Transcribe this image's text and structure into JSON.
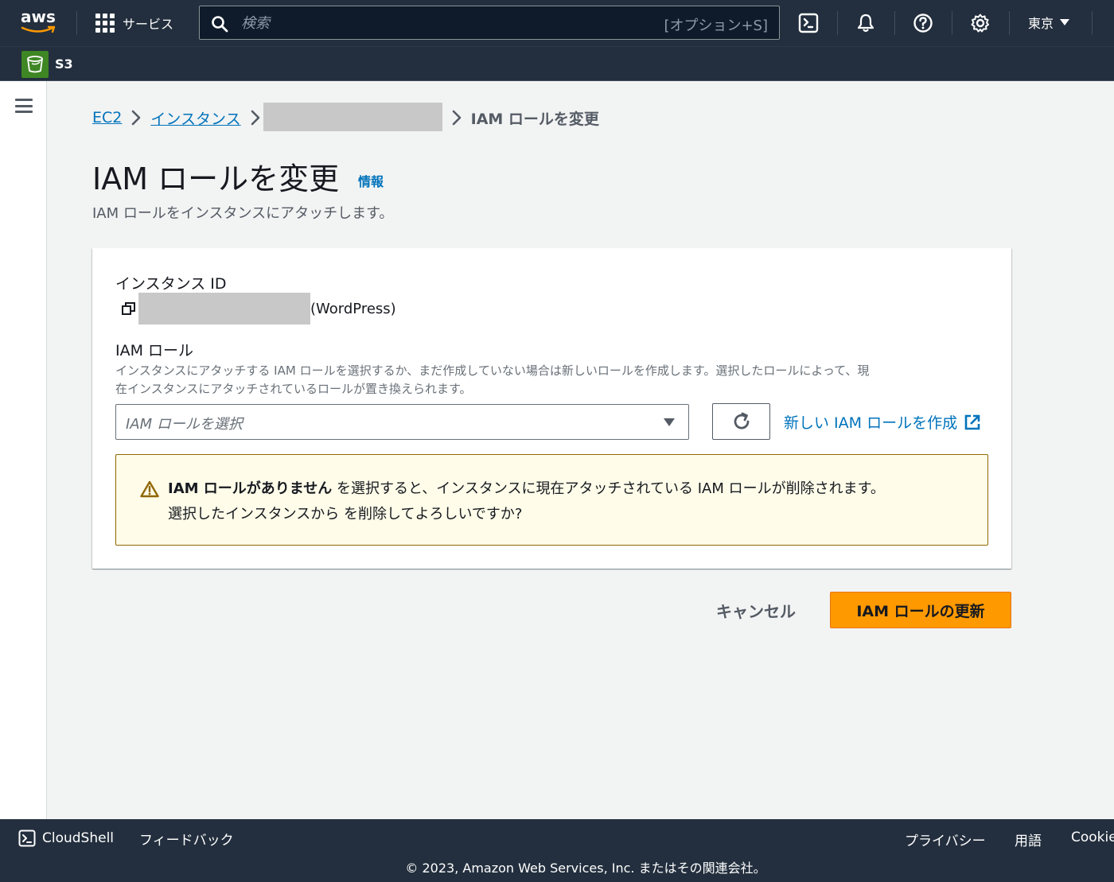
{
  "topnav": {
    "logo_text": "aws",
    "services_label": "サービス",
    "search_placeholder": "検索",
    "search_shortcut": "[オプション+S]",
    "region_label": "東京"
  },
  "subnav": {
    "service_label": "S3"
  },
  "breadcrumb": {
    "items": [
      "EC2",
      "インスタンス"
    ],
    "current": "IAM ロールを変更"
  },
  "page": {
    "title": "IAM ロールを変更",
    "info_label": "情報",
    "description": "IAM ロールをインスタンスにアタッチします。"
  },
  "form": {
    "instance_id_label": "インスタンス ID",
    "instance_suffix": "(WordPress)",
    "iam_role_label": "IAM ロール",
    "iam_role_help_1": "インスタンスにアタッチする IAM ロールを選択するか、まだ作成していない場合は新しいロールを作成します。選択したロールによって、現",
    "iam_role_help_2": "在インスタンスにアタッチされているロールが置き換えられます。",
    "select_placeholder": "IAM ロールを選択",
    "create_link": "新しい IAM ロールを作成"
  },
  "alert": {
    "strong": "IAM ロールがありません",
    "line1_rest": " を選択すると、インスタンスに現在アタッチされている IAM ロールが削除されます。",
    "line2": "選択したインスタンスから を削除してよろしいですか?"
  },
  "actions": {
    "cancel": "キャンセル",
    "submit": "IAM ロールの更新"
  },
  "footer": {
    "cloudshell": "CloudShell",
    "feedback": "フィードバック",
    "privacy": "プライバシー",
    "terms": "用語",
    "cookie": "Cookie",
    "copyright": "© 2023, Amazon Web Services, Inc. またはその関連会社。"
  },
  "colors": {
    "nav_bg": "#232f3e",
    "link": "#0073bb",
    "primary": "#ff9900",
    "warning_border": "#906806",
    "warning_bg": "#fffce9"
  }
}
